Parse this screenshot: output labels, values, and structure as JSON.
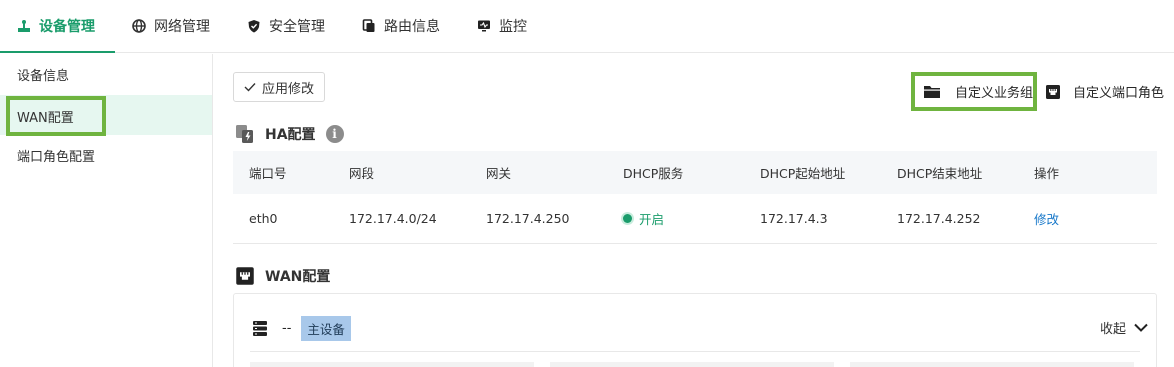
{
  "nav": {
    "tabs": [
      {
        "label": "设备管理",
        "icon": "device-management-icon",
        "active": true
      },
      {
        "label": "网络管理",
        "icon": "globe-icon"
      },
      {
        "label": "安全管理",
        "icon": "shield-icon"
      },
      {
        "label": "路由信息",
        "icon": "route-icon"
      },
      {
        "label": "监控",
        "icon": "monitor-icon"
      }
    ]
  },
  "sidebar": {
    "items": [
      {
        "label": "设备信息"
      },
      {
        "label": "WAN配置",
        "active": true
      },
      {
        "label": "端口角色配置"
      }
    ]
  },
  "toolbar": {
    "apply_label": "应用修改",
    "custom_group_label": "自定义业务组",
    "custom_port_label": "自定义端口角色"
  },
  "ha": {
    "title": "HA配置",
    "info": "i",
    "columns": [
      "端口号",
      "网段",
      "网关",
      "DHCP服务",
      "DHCP起始地址",
      "DHCP结束地址",
      "操作"
    ],
    "rows": [
      {
        "port": "eth0",
        "segment": "172.17.4.0/24",
        "gateway": "172.17.4.250",
        "dhcp": "开启",
        "start": "172.17.4.3",
        "end": "172.17.4.252",
        "action": "修改"
      }
    ]
  },
  "wan": {
    "title": "WAN配置",
    "device_dash": "--",
    "badge": "主设备",
    "collapse_label": "收起"
  },
  "colors": {
    "accent": "#1a9c6b",
    "highlight": "#6fb43f",
    "link": "#1677c9"
  }
}
